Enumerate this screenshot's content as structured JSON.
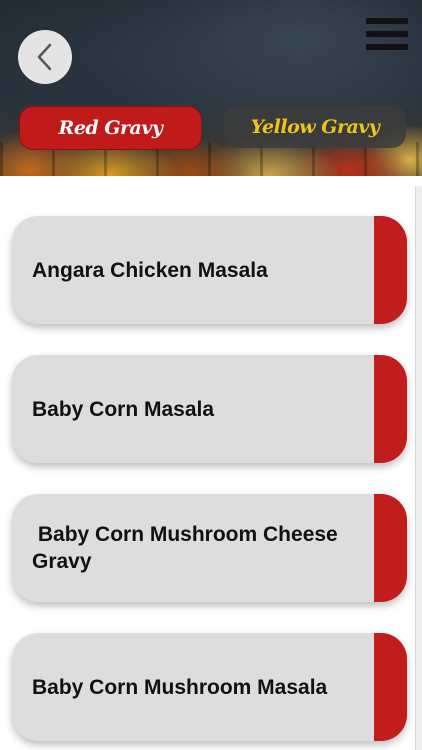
{
  "header": {
    "back_icon": "chevron-left-icon",
    "menu_icon": "hamburger-menu-icon"
  },
  "tabs": [
    {
      "label": "Red Gravy",
      "active": true,
      "color": "#c01a1a"
    },
    {
      "label": "Yellow Gravy",
      "active": false,
      "color": "#f2c21a"
    }
  ],
  "recipes": [
    {
      "name": "Angara Chicken Masala"
    },
    {
      "name": "Baby Corn Masala"
    },
    {
      "name": " Baby Corn Mushroom Cheese Gravy"
    },
    {
      "name": "Baby Corn Mushroom Masala"
    }
  ],
  "colors": {
    "accent": "#c21d1d",
    "card_bg": "#dddddd"
  }
}
